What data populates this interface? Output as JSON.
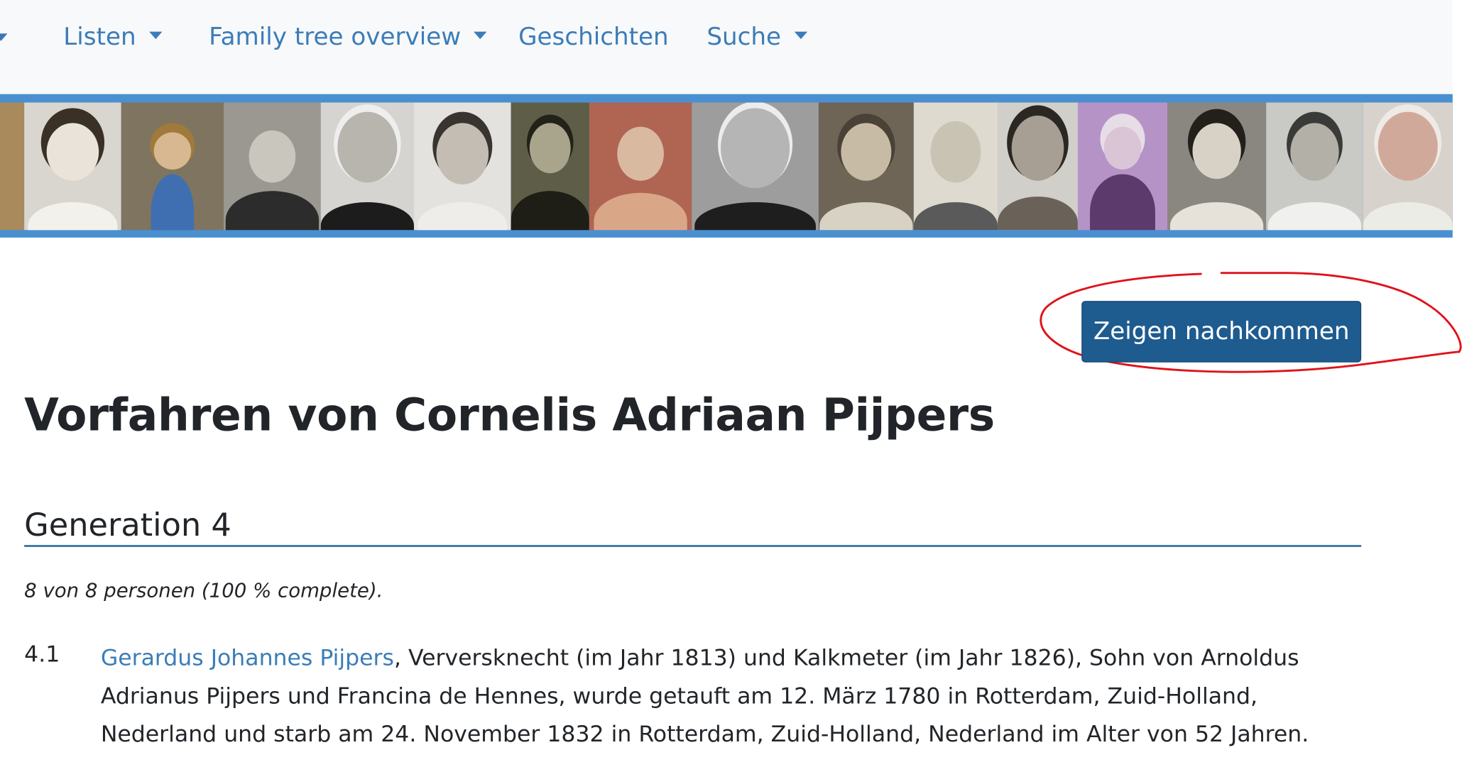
{
  "nav": {
    "items": [
      {
        "label": "Listen",
        "dropdown": true
      },
      {
        "label": "Family tree overview",
        "dropdown": true
      },
      {
        "label": "Geschichten",
        "dropdown": false
      },
      {
        "label": "Suche",
        "dropdown": true
      }
    ]
  },
  "action": {
    "show_descendants_label": "Zeigen nachkommen"
  },
  "page": {
    "title": "Vorfahren von Cornelis Adriaan Pijpers"
  },
  "generation": {
    "heading": "Generation 4",
    "summary": "8 von 8 personen (100 % complete)."
  },
  "entries": [
    {
      "number": "4.1",
      "person_link": "Gerardus Johannes Pijpers",
      "description": ", Verversknecht (im Jahr 1813) und Kalkmeter (im Jahr 1826), Sohn von Arnoldus Adrianus Pijpers und Francina de Hennes, wurde getauft am 12. März 1780 in Rotterdam, Zuid-Holland, Nederland und starb am 24. November 1832 in Rotterdam, Zuid-Holland, Nederland im Alter von 52 Jahren."
    }
  ],
  "colors": {
    "link": "#3b7cb8",
    "banner_border": "#4a90d0",
    "button_bg": "#1e5b8f",
    "annotation": "#e0121a",
    "rule": "#2d6a9f"
  }
}
